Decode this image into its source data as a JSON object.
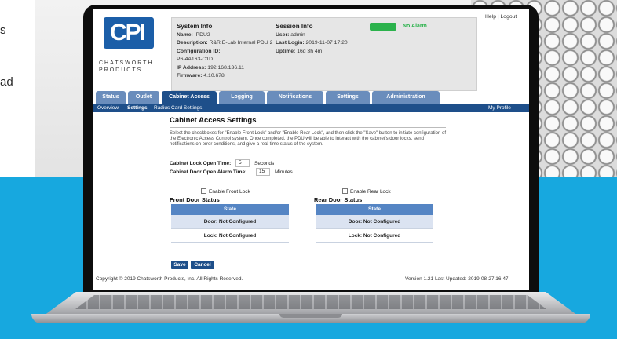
{
  "background": {
    "text_lines": [
      "s",
      "ad"
    ]
  },
  "screen": {
    "brand": {
      "mark": "CPI",
      "name_line1": "CHATSWORTH",
      "name_line2": "PRODUCTS"
    },
    "system_info": {
      "heading": "System Info",
      "name_label": "Name:",
      "name": "IPDU2",
      "description_label": "Description:",
      "description": "R&R E-Lab Internal PDU 2",
      "config_label": "Configuration ID:",
      "config_id": "P6-4A163-C1D",
      "ip_label": "IP Address:",
      "ip": "192.168.136.11",
      "firmware_label": "Firmware:",
      "firmware": "4.10.678"
    },
    "session_info": {
      "heading": "Session Info",
      "user_label": "User:",
      "user": "admin",
      "last_login_label": "Last Login:",
      "last_login": "2019-11-07 17:20",
      "uptime_label": "Uptime:",
      "uptime": "16d 3h 4m"
    },
    "alarm": {
      "status": "No Alarm",
      "color": "#2bb24c"
    },
    "top_links": {
      "help": "Help",
      "separator": " | ",
      "logout": "Logout"
    },
    "tabs": [
      "Status",
      "Outlet",
      "Cabinet Access",
      "Logging",
      "Notifications",
      "Settings",
      "Administration"
    ],
    "active_tab": "Cabinet Access",
    "subnav": {
      "overview": "Overview",
      "settings": "Settings",
      "radius": "Radius Card Settings",
      "profile": "My Profile"
    },
    "page": {
      "title": "Cabinet Access Settings",
      "description": "Select the checkboxes for \"Enable Front Lock\" and/or \"Enable Rear Lock\", and then click the \"Save\" button to initiate configuration of the Electronic Access Control system. Once completed, the PDU will be able to interact with the cabinet's door locks, send notifications on error conditions, and give a real-time status of the system.",
      "lock_open_label": "Cabinet Lock Open Time:",
      "lock_open_value": "5",
      "lock_open_unit": "Seconds",
      "alarm_time_label": "Cabinet Door Open Alarm Time:",
      "alarm_time_value": "15",
      "alarm_time_unit": "Minutes",
      "enable_front": "Enable Front Lock",
      "enable_rear": "Enable Rear Lock",
      "front_title": "Front Door Status",
      "rear_title": "Rear Door Status",
      "state_header": "State",
      "front_rows": [
        "Door: Not Configured",
        "Lock: Not Configured"
      ],
      "rear_rows": [
        "Door: Not Configured",
        "Lock: Not Configured"
      ],
      "save": "Save",
      "cancel": "Cancel"
    },
    "footer": {
      "copyright": "Copyright © 2019 Chatsworth Products, Inc. All Rights Reserved.",
      "version": "Version 1.21 Last Updated: 2019-08-27 16:47"
    }
  },
  "colors": {
    "accent_blue": "#1e4f8a",
    "tab_blue": "#6a8dbc",
    "scene_blue": "#17a8df",
    "brand_blue": "#1b5ea8"
  }
}
